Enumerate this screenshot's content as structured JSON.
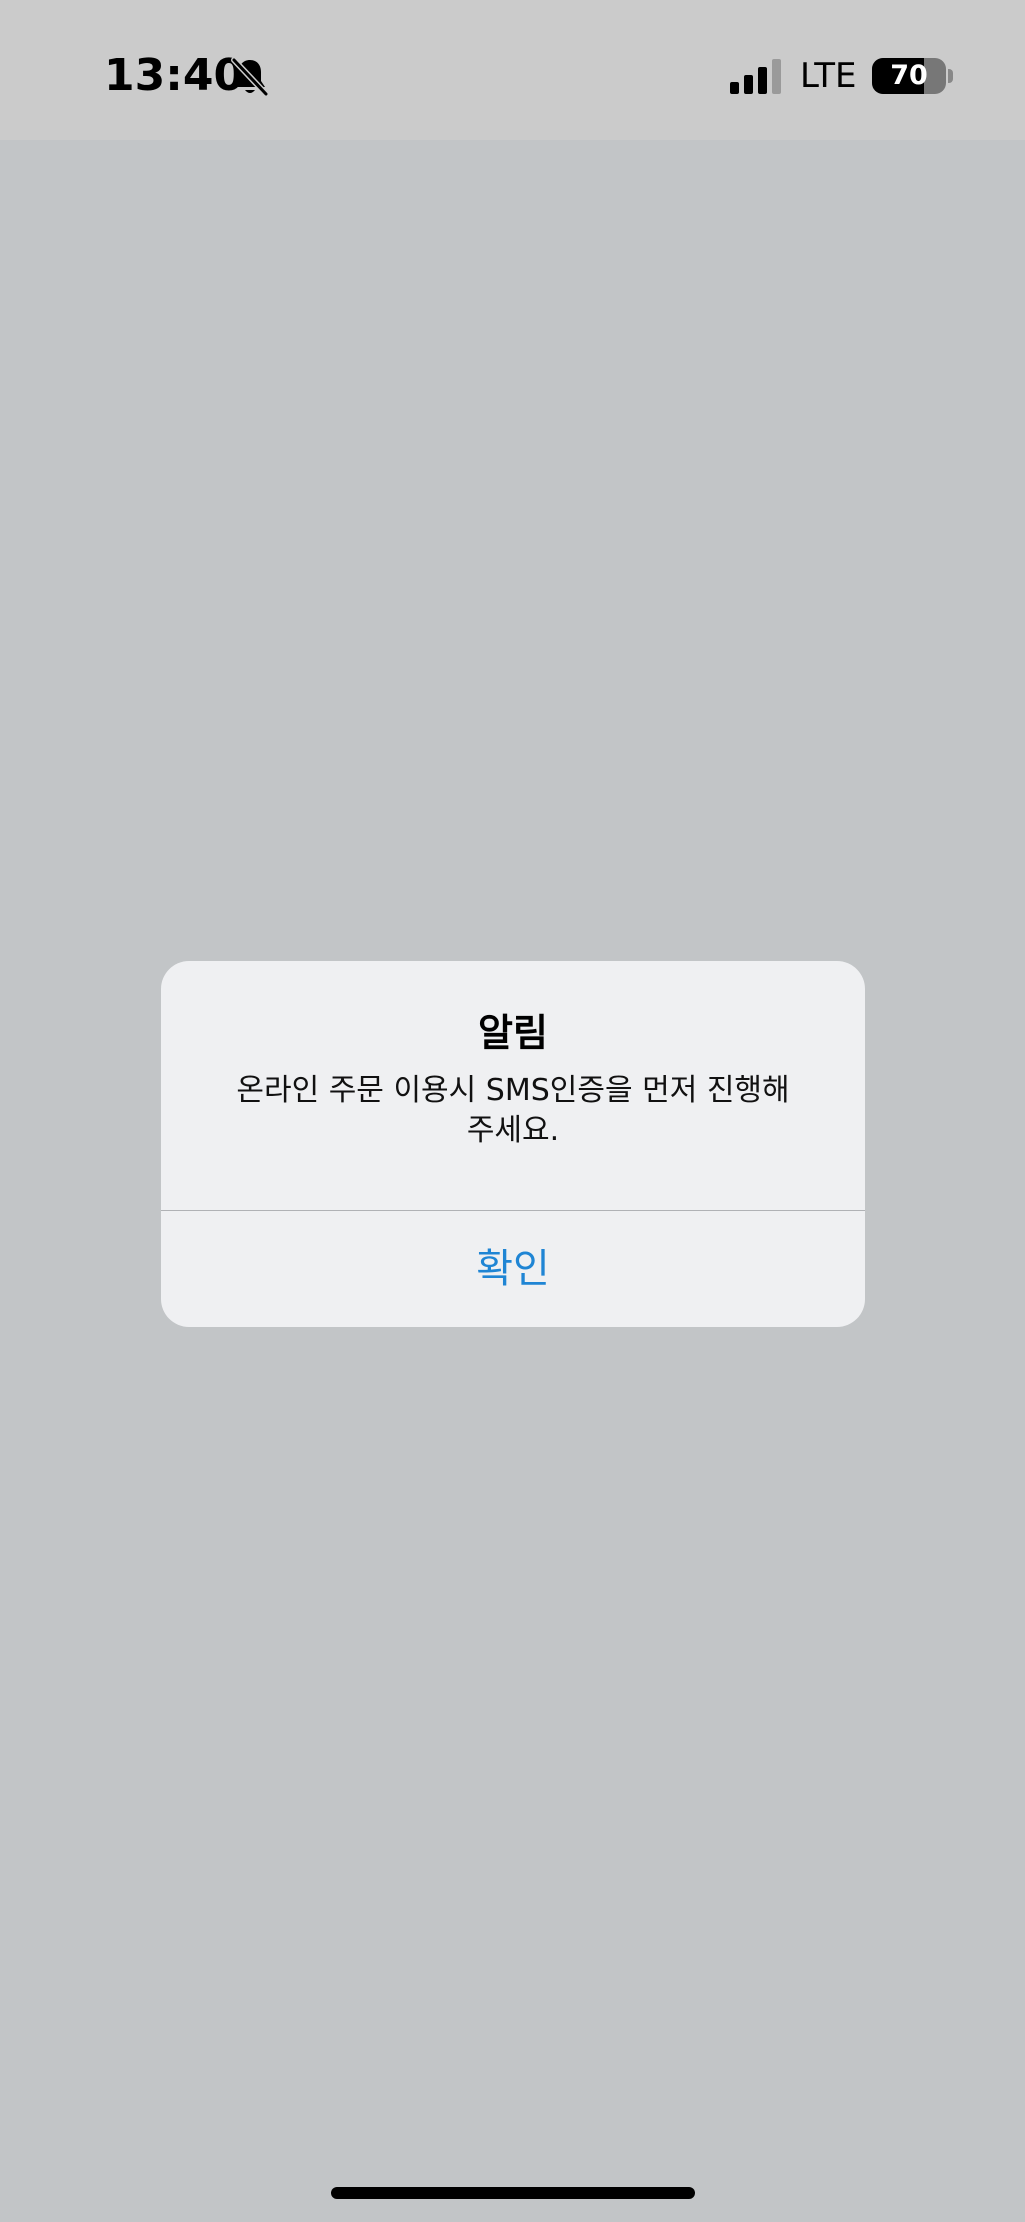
{
  "status_bar": {
    "time": "13:40",
    "mute_icon": "bell-slash-icon",
    "signal_icon": "cellular-signal-icon",
    "signal_bars_active": 3,
    "signal_bars_total": 4,
    "network": "LTE",
    "battery_icon": "battery-icon",
    "battery_level": "70",
    "battery_fraction": 0.7
  },
  "alert": {
    "title": "알림",
    "message": "온라인 주문 이용시 SMS인증을 먼저 진행해 주세요.",
    "confirm_label": "확인"
  },
  "colors": {
    "background": "#c2c5c7",
    "status_bar_background": "#cbcbcb",
    "alert_background": "#eff0f2",
    "button_text": "#1f85d4"
  }
}
